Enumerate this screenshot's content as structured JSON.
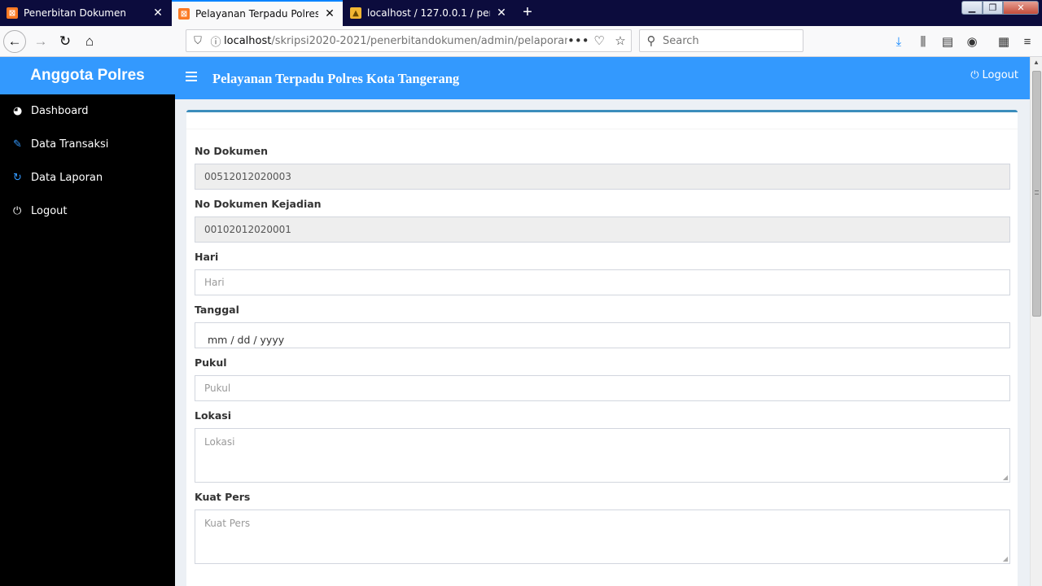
{
  "browser": {
    "tabs": [
      {
        "title": "Penerbitan Dokumen",
        "favicon": "xampp-icon",
        "active": false
      },
      {
        "title": "Pelayanan Terpadu Polres Kota",
        "favicon": "xampp-icon",
        "active": true
      },
      {
        "title": "localhost / 127.0.0.1 / penerbita",
        "favicon": "phpmyadmin-icon",
        "active": false
      }
    ],
    "url_host": "localhost",
    "url_path": "/skripsi2020-2021/penerbitandokumen/admin/pelaporan/",
    "search_placeholder": "Search"
  },
  "sidebar": {
    "brand": "Anggota Polres",
    "items": [
      {
        "label": "Dashboard",
        "icon": "dashboard-icon"
      },
      {
        "label": "Data Transaksi",
        "icon": "edit-icon"
      },
      {
        "label": "Data Laporan",
        "icon": "refresh-icon"
      },
      {
        "label": "Logout",
        "icon": "power-icon"
      }
    ]
  },
  "header": {
    "title": "Pelayanan Terpadu Polres Kota Tangerang",
    "logout_label": "Logout"
  },
  "form": {
    "no_dokumen": {
      "label": "No Dokumen",
      "value": "00512012020003"
    },
    "no_dokumen_kejadian": {
      "label": "No Dokumen Kejadian",
      "value": "00102012020001"
    },
    "hari": {
      "label": "Hari",
      "placeholder": "Hari"
    },
    "tanggal": {
      "label": "Tanggal",
      "placeholder": "mm / dd / yyyy"
    },
    "pukul": {
      "label": "Pukul",
      "placeholder": "Pukul"
    },
    "lokasi": {
      "label": "Lokasi",
      "placeholder": "Lokasi"
    },
    "kuat_pers": {
      "label": "Kuat Pers",
      "placeholder": "Kuat Pers"
    }
  },
  "colors": {
    "accent": "#3399fe",
    "sidebar_bg": "#000000",
    "card_border": "#3c8dbc"
  }
}
